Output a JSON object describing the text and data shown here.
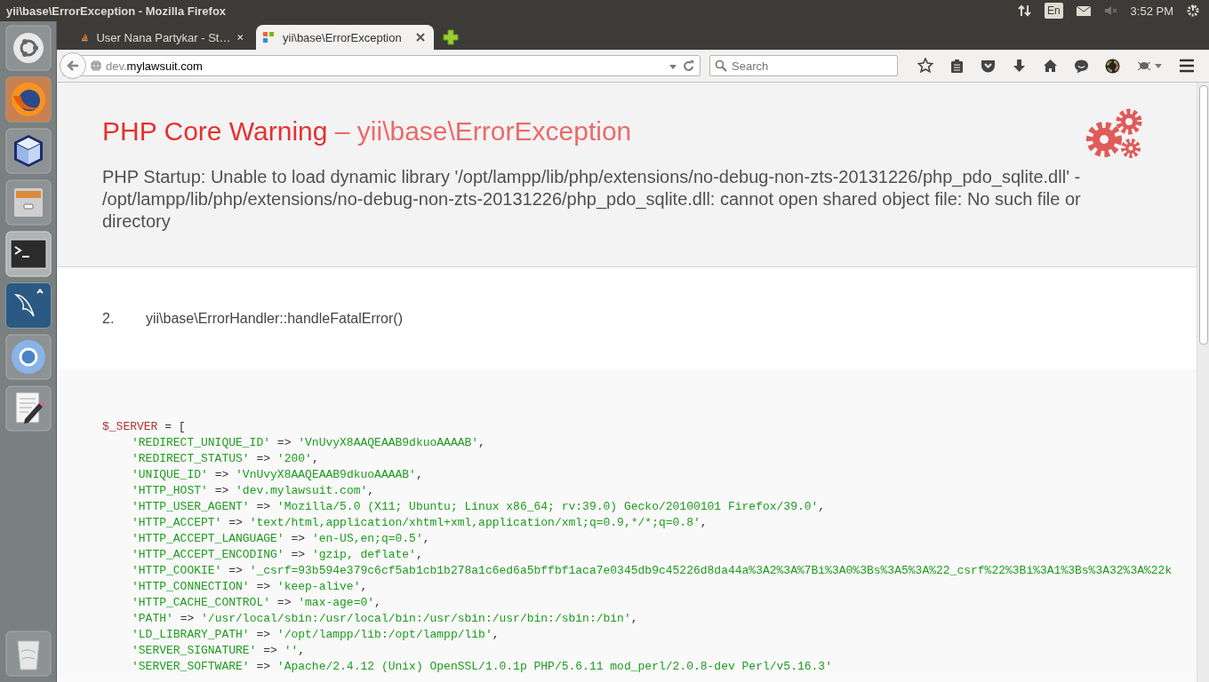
{
  "top_bar": {
    "window_title": "yii\\base\\ErrorException - Mozilla Firefox",
    "keyboard_layout": "En",
    "clock": "3:52 PM"
  },
  "tabs": [
    {
      "label": "User Nana Partykar - St…",
      "selected": false
    },
    {
      "label": "yii\\base\\ErrorException",
      "selected": true
    }
  ],
  "address_bar": {
    "url_prefix": "dev.",
    "url_domain": "mylawsuit.com"
  },
  "search": {
    "placeholder": "Search"
  },
  "error": {
    "title": "PHP Core Warning",
    "subtitle": "– yii\\base\\ErrorException",
    "message": "PHP Startup: Unable to load dynamic library '/opt/lampp/lib/php/extensions/no-debug-non-zts-20131226/php_pdo_sqlite.dll' - /opt/lampp/lib/php/extensions/no-debug-non-zts-20131226/php_pdo_sqlite.dll: cannot open shared object file: No such file or directory"
  },
  "call_stack": [
    {
      "number": "2.",
      "text": "yii\\base\\ErrorHandler::handleFatalError()"
    }
  ],
  "server_dump": {
    "opening": "$_SERVER = [",
    "entries": [
      {
        "key": "'REDIRECT_UNIQUE_ID'",
        "operator": "=>",
        "value": "'VnUvyX8AAQEAAB9dkuoAAAAB'",
        "end": ","
      },
      {
        "key": "'REDIRECT_STATUS'",
        "operator": "=>",
        "value": "'200'",
        "end": ","
      },
      {
        "key": "'UNIQUE_ID'",
        "operator": "=>",
        "value": "'VnUvyX8AAQEAAB9dkuoAAAAB'",
        "end": ","
      },
      {
        "key": "'HTTP_HOST'",
        "operator": "=>",
        "value": "'dev.mylawsuit.com'",
        "end": ","
      },
      {
        "key": "'HTTP_USER_AGENT'",
        "operator": "=>",
        "value": "'Mozilla/5.0 (X11; Ubuntu; Linux x86_64; rv:39.0) Gecko/20100101 Firefox/39.0'",
        "end": ","
      },
      {
        "key": "'HTTP_ACCEPT'",
        "operator": "=>",
        "value": "'text/html,application/xhtml+xml,application/xml;q=0.9,*/*;q=0.8'",
        "end": ","
      },
      {
        "key": "'HTTP_ACCEPT_LANGUAGE'",
        "operator": "=>",
        "value": "'en-US,en;q=0.5'",
        "end": ","
      },
      {
        "key": "'HTTP_ACCEPT_ENCODING'",
        "operator": "=>",
        "value": "'gzip, deflate'",
        "end": ","
      },
      {
        "key": "'HTTP_COOKIE'",
        "operator": "=>",
        "value": "'_csrf=93b594e379c6cf5ab1cb1b278a1c6ed6a5bffbf1aca7e0345db9c45226d8da44a%3A2%3A%7Bi%3A0%3Bs%3A5%3A%22_csrf%22%3Bi%3A1%3Bs%3A32%3A%22k"
      },
      {
        "key": "'HTTP_CONNECTION'",
        "operator": "=>",
        "value": "'keep-alive'",
        "end": ","
      },
      {
        "key": "'HTTP_CACHE_CONTROL'",
        "operator": "=>",
        "value": "'max-age=0'",
        "end": ","
      },
      {
        "key": "'PATH'",
        "operator": "=>",
        "value": "'/usr/local/sbin:/usr/local/bin:/usr/sbin:/usr/bin:/sbin:/bin'",
        "end": ","
      },
      {
        "key": "'LD_LIBRARY_PATH'",
        "operator": "=>",
        "value": "'/opt/lampp/lib:/opt/lampp/lib'",
        "end": ","
      },
      {
        "key": "'SERVER_SIGNATURE'",
        "operator": "=>",
        "value": "''",
        "end": ","
      },
      {
        "key": "'SERVER_SOFTWARE'",
        "operator": "=>",
        "value": "'Apache/2.4.12 (Unix) OpenSSL/1.0.1p PHP/5.6.11 mod_perl/2.0.8-dev Perl/v5.16.3'"
      }
    ]
  }
}
